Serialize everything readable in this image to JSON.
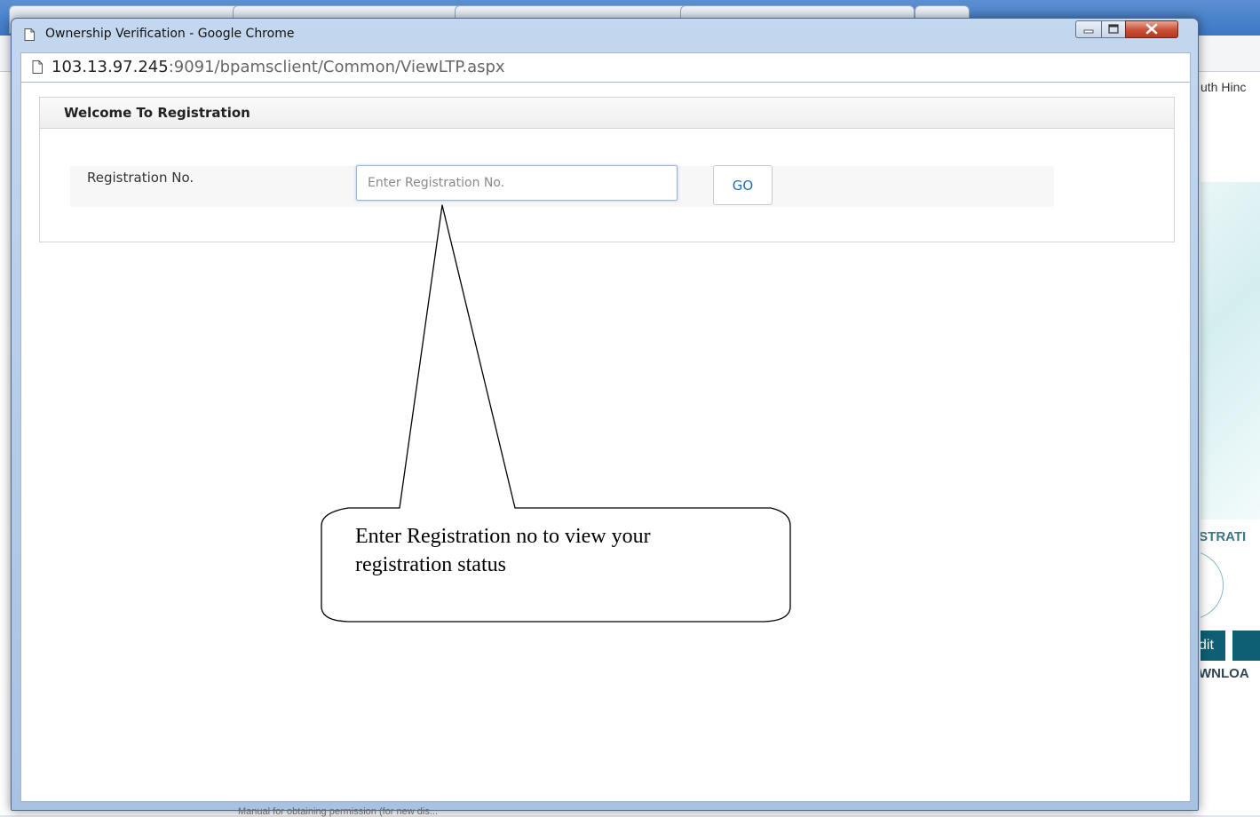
{
  "background_window": {
    "right_edge_text": "uth Hinc",
    "right_heading": "ISTRATI",
    "edit_button_label": "dit",
    "download_label": "WNLOA",
    "bottom_text": "Manual for obtaining permission (for new dis..."
  },
  "popup": {
    "title": "Ownership Verification - Google Chrome",
    "address": {
      "host": "103.13.97.245",
      "path": ":9091/bpamsclient/Common/ViewLTP.aspx"
    },
    "panel": {
      "heading": "Welcome To Registration",
      "registration_label": "Registration No.",
      "registration_input": {
        "value": "",
        "placeholder": "Enter Registration No."
      },
      "go_label": "GO"
    }
  },
  "callout": {
    "text": "Enter Registration no to view your registration status"
  }
}
